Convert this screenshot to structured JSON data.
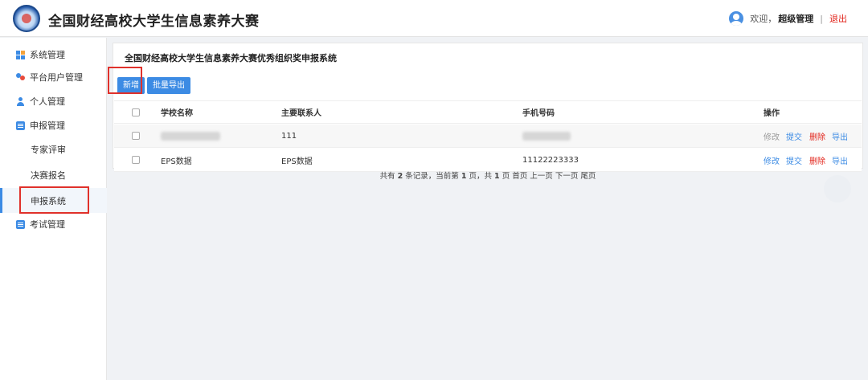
{
  "header": {
    "title": "全国财经高校大学生信息素养大赛",
    "welcome": "欢迎，",
    "username": "超级管理",
    "separator": "|",
    "logout": "退出"
  },
  "sidebar": {
    "items": [
      {
        "label": "系统管理",
        "icon": "grid-icon"
      },
      {
        "label": "平台用户管理",
        "icon": "users-icon"
      },
      {
        "label": "个人管理",
        "icon": "person-icon"
      },
      {
        "label": "申报管理",
        "icon": "document-icon"
      },
      {
        "label": "专家评审"
      },
      {
        "label": "决赛报名"
      },
      {
        "label": "申报系统",
        "active": true
      },
      {
        "label": "考试管理",
        "icon": "exam-icon"
      }
    ]
  },
  "main": {
    "title": "全国财经高校大学生信息素养大赛优秀组织奖申报系统",
    "buttons": {
      "add": "新增",
      "export": "批量导出"
    }
  },
  "table": {
    "columns": [
      "学校名称",
      "主要联系人",
      "手机号码",
      "操作"
    ],
    "rows": [
      {
        "school": "",
        "contact": "111",
        "phone": "",
        "ops": [
          "修改",
          "提交",
          "删除",
          "导出"
        ],
        "ops_enabled": false
      },
      {
        "school": "EPS数据",
        "contact": "EPS数据",
        "phone": "11122223333",
        "ops": [
          "修改",
          "提交",
          "删除",
          "导出"
        ],
        "ops_enabled": true
      }
    ]
  },
  "pagination": {
    "p1": "共有",
    "total": "2",
    "p2": "条记录，当前第",
    "current": "1",
    "p3": "页，共",
    "pages": "1",
    "p4": "页",
    "first": "首页",
    "prev": "上一页",
    "next": "下一页",
    "last": "尾页"
  },
  "colors": {
    "accent": "#3c8be4",
    "danger": "#e2231a",
    "highlight": "#e0312b"
  }
}
